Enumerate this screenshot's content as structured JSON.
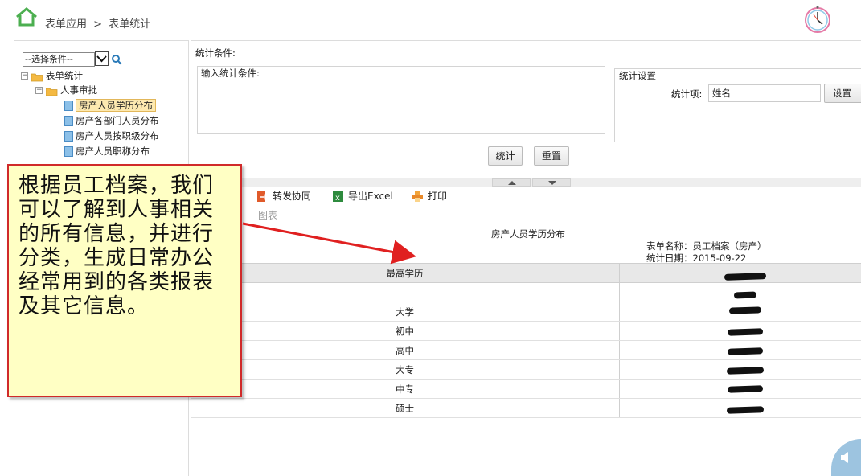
{
  "header": {
    "breadcrumb": [
      "表单应用",
      ">",
      "表单统计"
    ]
  },
  "sidebar": {
    "select_value": "--选择条件--",
    "tree": {
      "root": "表单统计",
      "group": "人事审批",
      "items": [
        {
          "label": "房产人员学历分布",
          "selected": true
        },
        {
          "label": "房产各部门人员分布",
          "selected": false
        },
        {
          "label": "房产人员按职级分布",
          "selected": false
        },
        {
          "label": "房产人员职称分布",
          "selected": false
        }
      ]
    }
  },
  "conditions": {
    "title": "统计条件:",
    "input_label": "输入统计条件:",
    "settings_title": "统计设置",
    "stat_item_label": "统计项:",
    "stat_item_value": "姓名",
    "set_button": "设置",
    "stat_button": "统计",
    "reset_button": "重置"
  },
  "toolbar": {
    "forward": "转发协同",
    "export": "导出Excel",
    "print": "打印",
    "chart": "图表"
  },
  "report": {
    "title": "房产人员学历分布",
    "form_name": "表单名称：员工档案（房产）",
    "stat_date": "统计日期：2015-09-22",
    "columns": [
      "最高学历",
      ""
    ],
    "rows": [
      "",
      "大学",
      "初中",
      "高中",
      "大专",
      "中专",
      "硕士"
    ]
  },
  "callout": {
    "text": "根据员工档案，我们可以了解到人事相关的所有信息，并进行分类，生成日常办公经常用到的各类报表及其它信息。"
  },
  "colors": {
    "home_icon": "#4caf50",
    "callout_bg": "#ffffc4",
    "callout_border": "#d02a2a",
    "arrow": "#e02020",
    "header_row_bg": "#e8e8e8",
    "speaker_bg": "#9dc4e0"
  }
}
